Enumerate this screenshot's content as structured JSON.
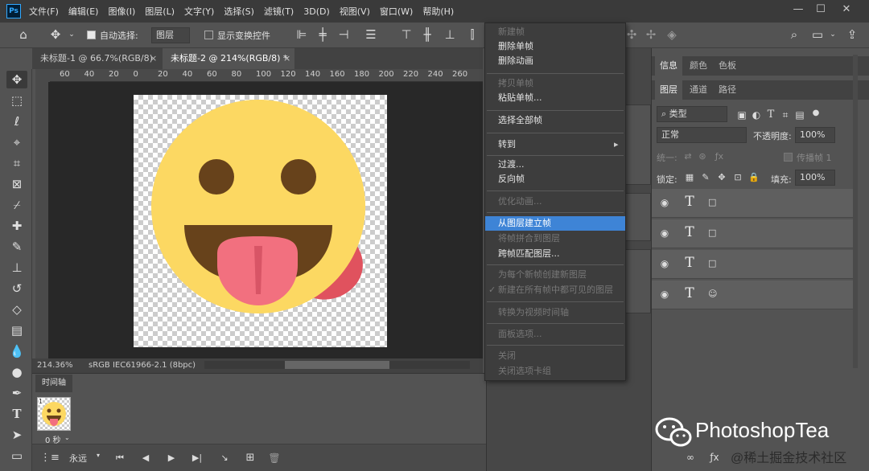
{
  "app": {
    "logo": "Ps"
  },
  "menubar": {
    "items": [
      "文件(F)",
      "编辑(E)",
      "图像(I)",
      "图层(L)",
      "文字(Y)",
      "选择(S)",
      "滤镜(T)",
      "3D(D)",
      "视图(V)",
      "窗口(W)",
      "帮助(H)"
    ],
    "minimize": "—",
    "maximize": "☐",
    "close": "✕"
  },
  "options": {
    "auto_select_label": "自动选择:",
    "auto_select_value": "图层",
    "show_transform_label": "显示变换控件"
  },
  "tabs": [
    {
      "label": "未标题-1 @ 66.7%(RGB/8)",
      "close": "×"
    },
    {
      "label": "未标题-2 @ 214%(RGB/8) *",
      "close": "×"
    }
  ],
  "ruler": {
    "ticks": [
      "60",
      "40",
      "20",
      "0",
      "20",
      "40",
      "60",
      "80",
      "100",
      "120",
      "140",
      "160",
      "180",
      "200",
      "220",
      "240",
      "260"
    ]
  },
  "status": {
    "zoom": "214.36%",
    "profile": "sRGB IEC61966-2.1 (8bpc)"
  },
  "timeline": {
    "tab_label": "时间轴",
    "frame_number": "1",
    "frame_delay": "0 秒",
    "loop": "永远"
  },
  "context_menu": {
    "items": [
      {
        "label": "新建帧",
        "disabled": true
      },
      {
        "label": "删除单帧",
        "disabled": false
      },
      {
        "label": "删除动画",
        "disabled": false
      },
      {
        "label": "拷贝单帧",
        "disabled": true
      },
      {
        "label": "粘贴单帧...",
        "disabled": false
      },
      {
        "label": "选择全部帧",
        "disabled": false
      },
      {
        "label": "转到",
        "disabled": false,
        "submenu_arrow": "▸"
      },
      {
        "label": "过渡...",
        "disabled": false
      },
      {
        "label": "反向帧",
        "disabled": false
      },
      {
        "label": "优化动画...",
        "disabled": true
      },
      {
        "label": "从图层建立帧",
        "disabled": false,
        "highlighted": true
      },
      {
        "label": "将帧拼合到图层",
        "disabled": true
      },
      {
        "label": "跨帧匹配图层...",
        "disabled": false
      },
      {
        "label": "为每个新帧创建新图层",
        "disabled": true
      },
      {
        "label": "新建在所有帧中都可见的图层",
        "disabled": true,
        "checkmark": "✓"
      },
      {
        "label": "转换为视频时间轴",
        "disabled": true
      },
      {
        "label": "面板选项...",
        "disabled": true
      },
      {
        "label": "关闭",
        "disabled": true
      },
      {
        "label": "关闭选项卡组",
        "disabled": true
      }
    ]
  },
  "panels": {
    "top_tabs": [
      "信息",
      "颜色",
      "色板"
    ],
    "layer_tabs": [
      "图层",
      "通道",
      "路径"
    ],
    "filter_kind": "类型",
    "blend_mode": "正常",
    "opacity_label": "不透明度:",
    "opacity_value": "100%",
    "unify_label": "统一:",
    "propagate_label": "传播帧 1",
    "lock_label": "锁定:",
    "fill_label": "填充:",
    "fill_value": "100%",
    "layers": [
      {
        "type_glyph": "T",
        "name": "□"
      },
      {
        "type_glyph": "T",
        "name": "□"
      },
      {
        "type_glyph": "T",
        "name": "□"
      },
      {
        "type_glyph": "T",
        "name": "☺"
      }
    ]
  },
  "watermark": {
    "brand": "PhotoshopTea",
    "sub": "@稀土掘金技术社区"
  },
  "colors": {
    "emoji_face": "#fcd862",
    "emoji_feature": "#67421b",
    "tongue": "#f2707f",
    "highlight": "#3e84d6"
  }
}
